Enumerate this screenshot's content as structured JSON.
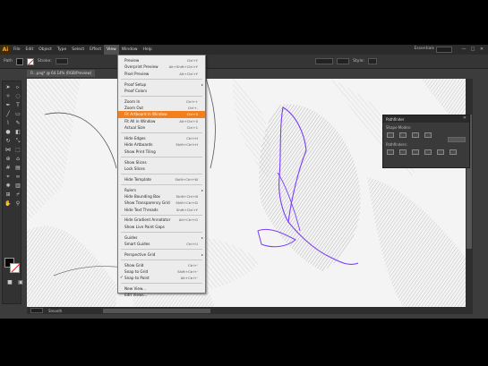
{
  "app": {
    "logo": "Ai",
    "menus": [
      "File",
      "Edit",
      "Object",
      "Type",
      "Select",
      "Effect",
      "View",
      "Window",
      "Help"
    ],
    "active_menu_index": 6,
    "workspace": "Essentials",
    "window_buttons": [
      "—",
      "□",
      "✕"
    ]
  },
  "control": {
    "left_label": "Path",
    "stroke_label": "Stroke:",
    "style_label": "Style:"
  },
  "document_tab": "Fi...png* @ 64.14% (RGB/Preview)",
  "view_menu": {
    "groups": [
      [
        {
          "label": "Preview",
          "shortcut": "Ctrl+Y"
        },
        {
          "label": "Overprint Preview",
          "shortcut": "Alt+Shift+Ctrl+Y"
        },
        {
          "label": "Pixel Preview",
          "shortcut": "Alt+Ctrl+Y"
        }
      ],
      [
        {
          "label": "Proof Setup",
          "arrow": "▸"
        },
        {
          "label": "Proof Colors"
        }
      ],
      [
        {
          "label": "Zoom In",
          "shortcut": "Ctrl++"
        },
        {
          "label": "Zoom Out",
          "shortcut": "Ctrl+-"
        },
        {
          "label": "Fit Artboard in Window",
          "shortcut": "Ctrl+0",
          "highlight": true
        },
        {
          "label": "Fit All in Window",
          "shortcut": "Alt+Ctrl+0"
        },
        {
          "label": "Actual Size",
          "shortcut": "Ctrl+1"
        }
      ],
      [
        {
          "label": "Hide Edges",
          "shortcut": "Ctrl+H"
        },
        {
          "label": "Hide Artboards",
          "shortcut": "Shift+Ctrl+H"
        },
        {
          "label": "Show Print Tiling"
        }
      ],
      [
        {
          "label": "Show Slices"
        },
        {
          "label": "Lock Slices"
        }
      ],
      [
        {
          "label": "Hide Template",
          "shortcut": "Shift+Ctrl+W"
        }
      ],
      [
        {
          "label": "Rulers",
          "arrow": "▸"
        },
        {
          "label": "Hide Bounding Box",
          "shortcut": "Shift+Ctrl+B"
        },
        {
          "label": "Show Transparency Grid",
          "shortcut": "Shift+Ctrl+D"
        },
        {
          "label": "Hide Text Threads",
          "shortcut": "Shift+Ctrl+Y"
        }
      ],
      [
        {
          "label": "Hide Gradient Annotator",
          "shortcut": "Alt+Ctrl+G"
        },
        {
          "label": "Show Live Paint Gaps"
        }
      ],
      [
        {
          "label": "Guides",
          "arrow": "▸"
        },
        {
          "label": "Smart Guides",
          "shortcut": "Ctrl+U"
        }
      ],
      [
        {
          "label": "Perspective Grid",
          "arrow": "▸"
        }
      ],
      [
        {
          "label": "Show Grid",
          "shortcut": "Ctrl+'"
        },
        {
          "label": "Snap to Grid",
          "shortcut": "Shift+Ctrl+'"
        },
        {
          "label": "Snap to Point",
          "shortcut": "Alt+Ctrl+'",
          "checked": true
        }
      ],
      [
        {
          "label": "New View..."
        },
        {
          "label": "Edit Views..."
        }
      ]
    ]
  },
  "panel": {
    "tabs": "Pathfinder",
    "shape_modes": "Shape Modes:",
    "pathfinders": "Pathfinders:",
    "close": "✕"
  },
  "status": {
    "tool": "Smooth"
  }
}
